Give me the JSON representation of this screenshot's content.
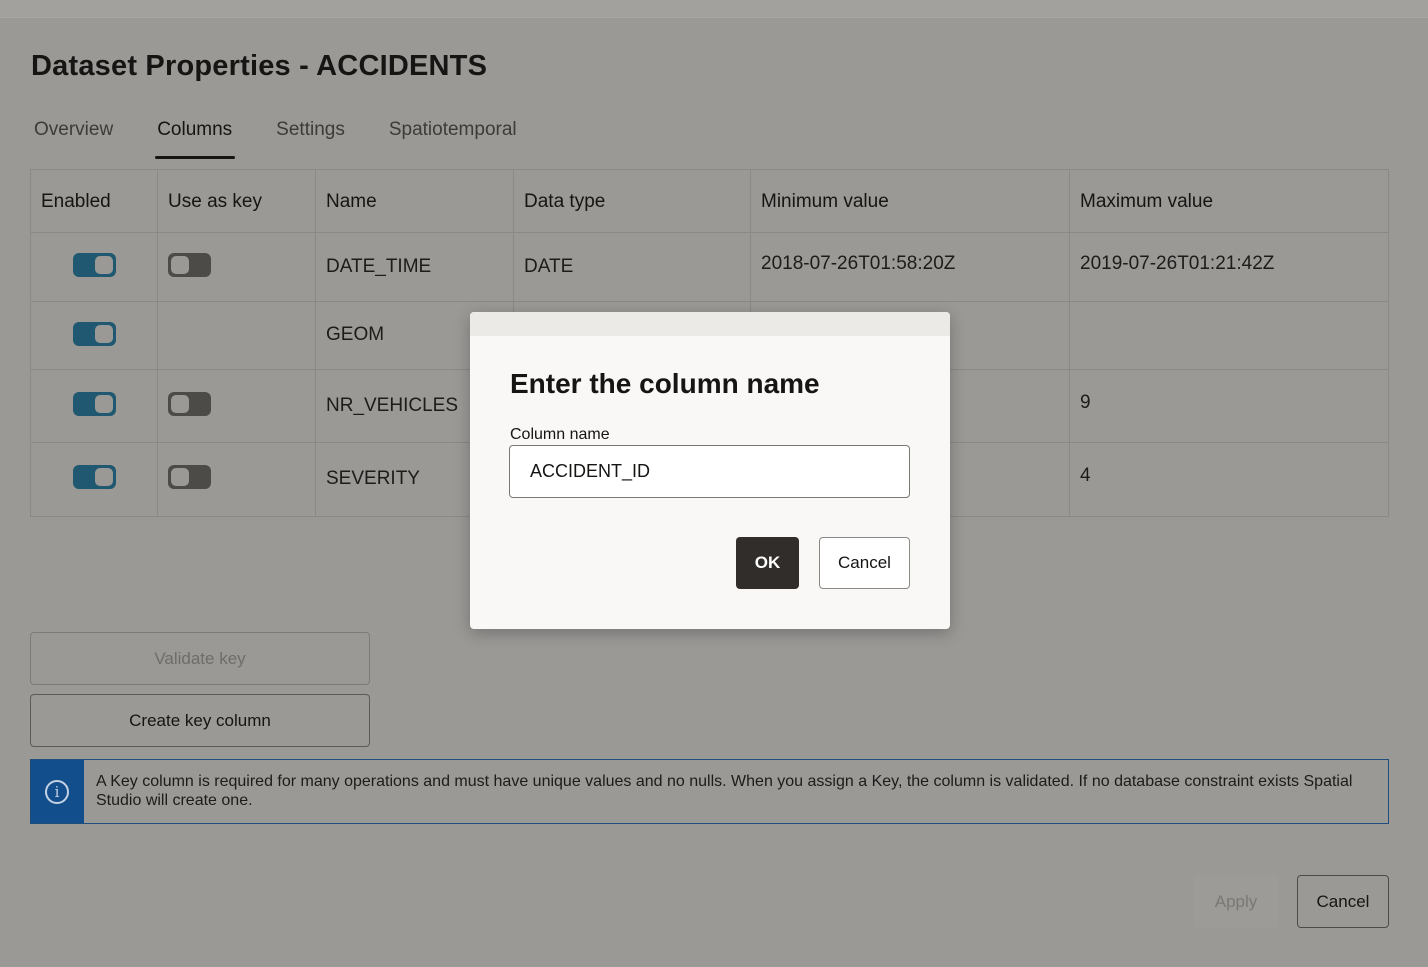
{
  "page": {
    "title": "Dataset Properties - ACCIDENTS",
    "tabs": [
      {
        "label": "Overview"
      },
      {
        "label": "Columns"
      },
      {
        "label": "Settings"
      },
      {
        "label": "Spatiotemporal"
      }
    ],
    "active_tab": "Columns"
  },
  "table": {
    "headers": [
      "Enabled",
      "Use as key",
      "Name",
      "Data type",
      "Minimum value",
      "Maximum value"
    ],
    "rows": [
      {
        "enabled": true,
        "use_as_key": false,
        "name": "DATE_TIME",
        "data_type": "DATE",
        "min": "2018-07-26T01:58:20Z",
        "max": "2019-07-26T01:21:42Z"
      },
      {
        "enabled": true,
        "use_as_key": null,
        "name": "GEOM",
        "data_type": "",
        "min": "",
        "max": ""
      },
      {
        "enabled": true,
        "use_as_key": false,
        "name": "NR_VEHICLES",
        "data_type": "",
        "min": "",
        "max": "9"
      },
      {
        "enabled": true,
        "use_as_key": false,
        "name": "SEVERITY",
        "data_type": "",
        "min": "",
        "max": "4"
      }
    ]
  },
  "actions": {
    "validate_key": "Validate key",
    "create_key_column": "Create key column"
  },
  "info": {
    "icon": "info-icon",
    "text": "A Key column is required for many operations and must have unique values and no nulls. When you assign a Key, the column is validated. If no database constraint exists Spatial Studio will create one."
  },
  "footer": {
    "apply": "Apply",
    "cancel": "Cancel"
  },
  "modal": {
    "title": "Enter the column name",
    "field_label": "Column name",
    "field_value": "ACCIDENT_ID",
    "ok": "OK",
    "cancel": "Cancel"
  },
  "colors": {
    "toggle_on": "#1f5870",
    "toggle_off": "#4d4b48",
    "info_bar": "#134e8c",
    "ok_button": "#312d2a"
  }
}
